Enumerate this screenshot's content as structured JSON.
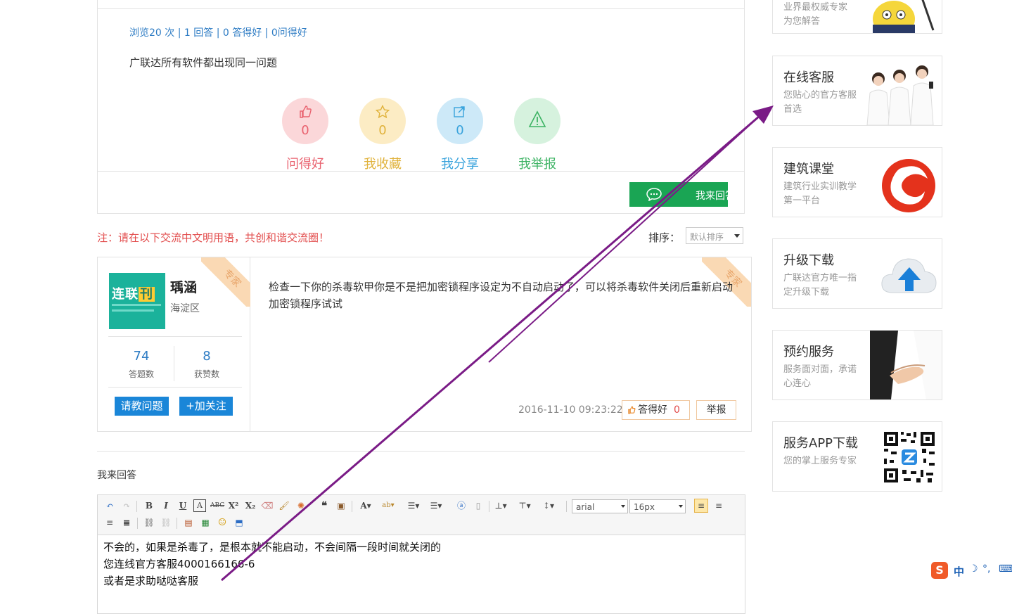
{
  "question": {
    "stats": "浏览20 次 | 1 回答 | 0 答得好 | 0问得好",
    "text": "广联达所有软件都出现同一问题",
    "actions": [
      {
        "label": "问得好",
        "count": "0",
        "color": "#e9626f",
        "bg": "#fbd7d9",
        "icon": "thumbs-up-icon"
      },
      {
        "label": "我收藏",
        "count": "0",
        "color": "#e0b23b",
        "bg": "#fcecc4",
        "icon": "star-icon"
      },
      {
        "label": "我分享",
        "count": "0",
        "color": "#39a3dc",
        "bg": "#cde9f8",
        "icon": "share-icon"
      },
      {
        "label": "我举报",
        "count": "",
        "color": "#3cb363",
        "bg": "#d6f2de",
        "icon": "warning-icon"
      }
    ],
    "answer_button": "我来回答"
  },
  "notice": "注：请在以下交流中文明用语，共创和谐交流圈！",
  "sort": {
    "label": "排序：",
    "selected": "默认排序"
  },
  "answer": {
    "user": {
      "name": "瑀涵",
      "location": "海淀区",
      "logo_text": "连联",
      "logo_badge": "刊",
      "badge": "专家",
      "answers_count": "74",
      "answers_label": "答题数",
      "likes_count": "8",
      "likes_label": "获赞数",
      "ask_button": "请教问题",
      "follow_button": "+加关注"
    },
    "badge": "专家",
    "text": "检查一下你的杀毒软甲你是不是把加密锁程序设定为不自动启动了，可以将杀毒软件关闭后重新启动加密锁程序试试",
    "date": "2016-11-10 09:23:22",
    "good_label": "答得好",
    "good_count": "0",
    "report_label": "举报"
  },
  "my_answer": {
    "title": "我来回答",
    "font_select": "arial",
    "size_select": "16px",
    "content_lines": [
      "不会的，如果是杀毒了，是根本就不能启动，不会间隔一段时间就关闭的",
      "您连线官方客服4000166166-6",
      "或者是求助哒哒客服"
    ]
  },
  "sidebar": {
    "top_partial": {
      "subtitle_line1": "业界最权威专家",
      "subtitle_line2": "为您解答"
    },
    "cards": [
      {
        "title": "在线客服",
        "subtitle": "您贴心的官方客服首选"
      },
      {
        "title": "建筑课堂",
        "subtitle": "建筑行业实训教学第一平台"
      },
      {
        "title": "升级下载",
        "subtitle": "广联达官方唯一指定升级下载"
      },
      {
        "title": "预约服务",
        "subtitle": "服务面对面，承诺心连心"
      },
      {
        "title": "服务APP下载",
        "subtitle": "您的掌上服务专家"
      }
    ]
  },
  "ime": {
    "label": "中"
  },
  "colors": {
    "link": "#2e7cc4",
    "green": "#1aa554",
    "arrow": "#7a1b86",
    "notice": "#e24b4b"
  }
}
